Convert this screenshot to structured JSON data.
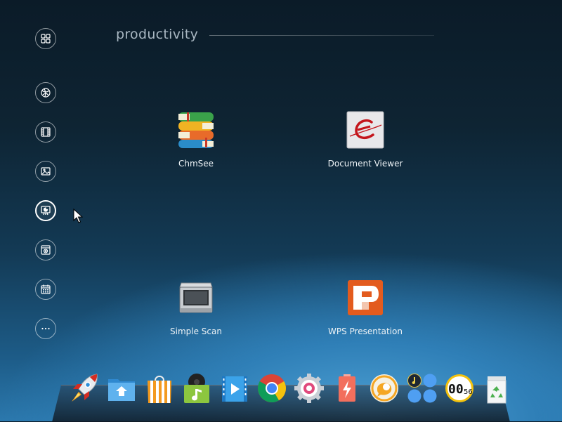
{
  "section_title": "productivity",
  "categories": [
    {
      "icon": "all-apps-icon",
      "active": false
    },
    {
      "icon": "internet-icon",
      "active": false
    },
    {
      "icon": "video-icon",
      "active": false
    },
    {
      "icon": "image-icon",
      "active": false
    },
    {
      "icon": "office-icon",
      "active": true
    },
    {
      "icon": "system-icon",
      "active": false
    },
    {
      "icon": "calendar-icon",
      "active": false
    },
    {
      "icon": "more-icon",
      "active": false
    }
  ],
  "apps": [
    {
      "name": "ChmSee",
      "icon": "chmsee-icon"
    },
    {
      "name": "Document Viewer",
      "icon": "document-viewer-icon"
    },
    {
      "name": "Simple Scan",
      "icon": "simple-scan-icon"
    },
    {
      "name": "WPS Presentation",
      "icon": "wps-presentation-icon"
    }
  ],
  "dock": [
    "launcher-rocket-icon",
    "file-manager-icon",
    "software-center-icon",
    "music-player-icon",
    "video-player-icon",
    "chrome-icon",
    "control-center-icon",
    "power-icon",
    "messenger-icon",
    "media-widget-icon",
    "clock-icon",
    "trash-icon"
  ],
  "clock_widget": {
    "hour": "00",
    "minute": "56"
  },
  "colors": {
    "accent": "#e35b1e",
    "active_border": "#ffffff"
  }
}
